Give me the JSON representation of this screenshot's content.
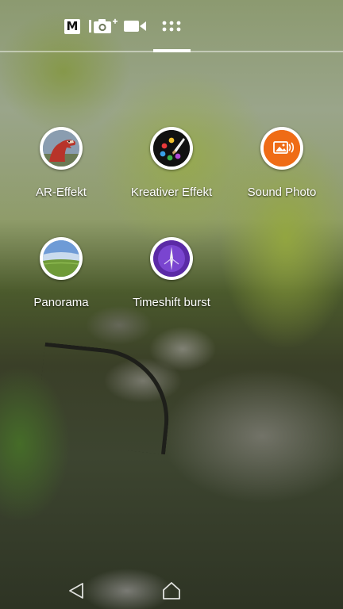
{
  "top_bar": {
    "modes": [
      {
        "name": "manual",
        "icon": "manual-mode-icon",
        "glyph": "M"
      },
      {
        "name": "photo",
        "icon": "camera-plus-icon"
      },
      {
        "name": "video",
        "icon": "video-camera-icon"
      },
      {
        "name": "apps",
        "icon": "grid-dots-icon",
        "active": true
      }
    ]
  },
  "apps": [
    {
      "label": "AR-Effekt",
      "icon": "dinosaur-icon"
    },
    {
      "label": "Kreativer Effekt",
      "icon": "palette-icon"
    },
    {
      "label": "Sound Photo",
      "icon": "sound-photo-icon"
    },
    {
      "label": "Panorama",
      "icon": "panorama-icon"
    },
    {
      "label": "Timeshift burst",
      "icon": "timeshift-burst-icon"
    }
  ],
  "nav_bar": {
    "buttons": [
      {
        "name": "back",
        "icon": "back-triangle-icon"
      },
      {
        "name": "home",
        "icon": "home-icon"
      }
    ]
  },
  "colors": {
    "accent_white": "#ffffff",
    "sound_photo_orange": "#ef6c16",
    "timeshift_purple": "#5b2aa6"
  }
}
